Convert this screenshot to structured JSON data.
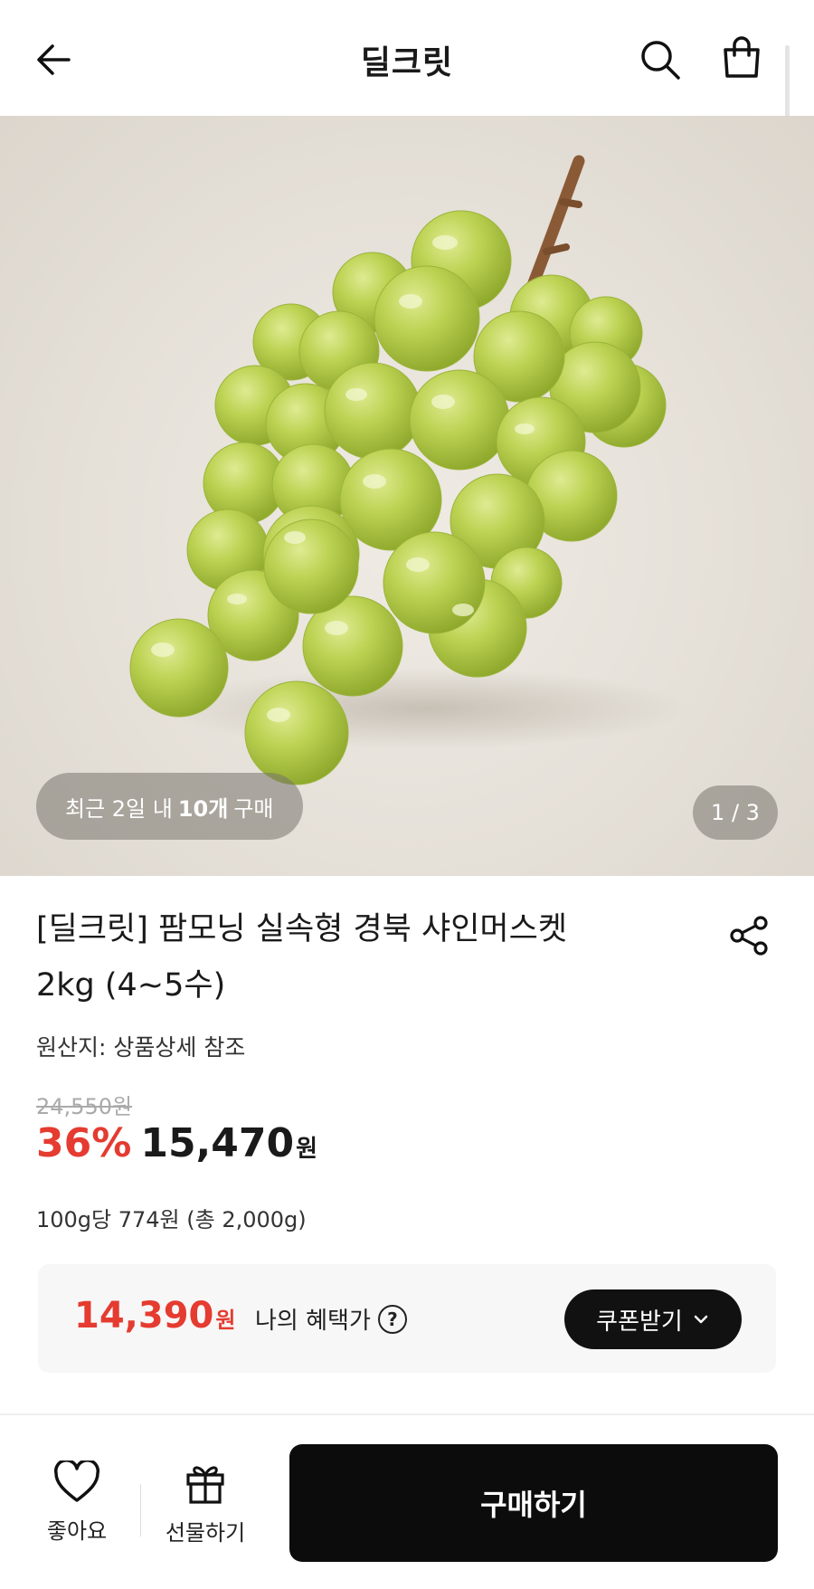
{
  "header": {
    "title": "딜크릿",
    "back_icon": "arrow-left-icon",
    "search_icon": "search-icon",
    "cart_icon": "shopping-bag-icon"
  },
  "hero": {
    "recent_prefix": "최근 2일 내",
    "recent_count": "10개",
    "recent_suffix": "구매",
    "page_counter": "1 / 3"
  },
  "product": {
    "title": "[딜크릿] 팜모닝 실속형 경북 샤인머스켓 2kg (4~5수)",
    "origin": "원산지: 상품상세 참조",
    "original_price": "24,550원",
    "discount": "36%",
    "price": "15,470",
    "currency": "원",
    "unit_price": "100g당 774원 (총 2,000g)",
    "share_icon": "share-icon"
  },
  "benefit": {
    "amount": "14,390",
    "currency": "원",
    "label": "나의 혜택가",
    "help": "?",
    "coupon_button": "쿠폰받기"
  },
  "bottom_bar": {
    "like_label": "좋아요",
    "gift_label": "선물하기",
    "buy_label": "구매하기"
  },
  "colors": {
    "accent_red": "#e53b30",
    "buy_button": "#0c0c0c",
    "grape_green": "#b6cd4a"
  }
}
